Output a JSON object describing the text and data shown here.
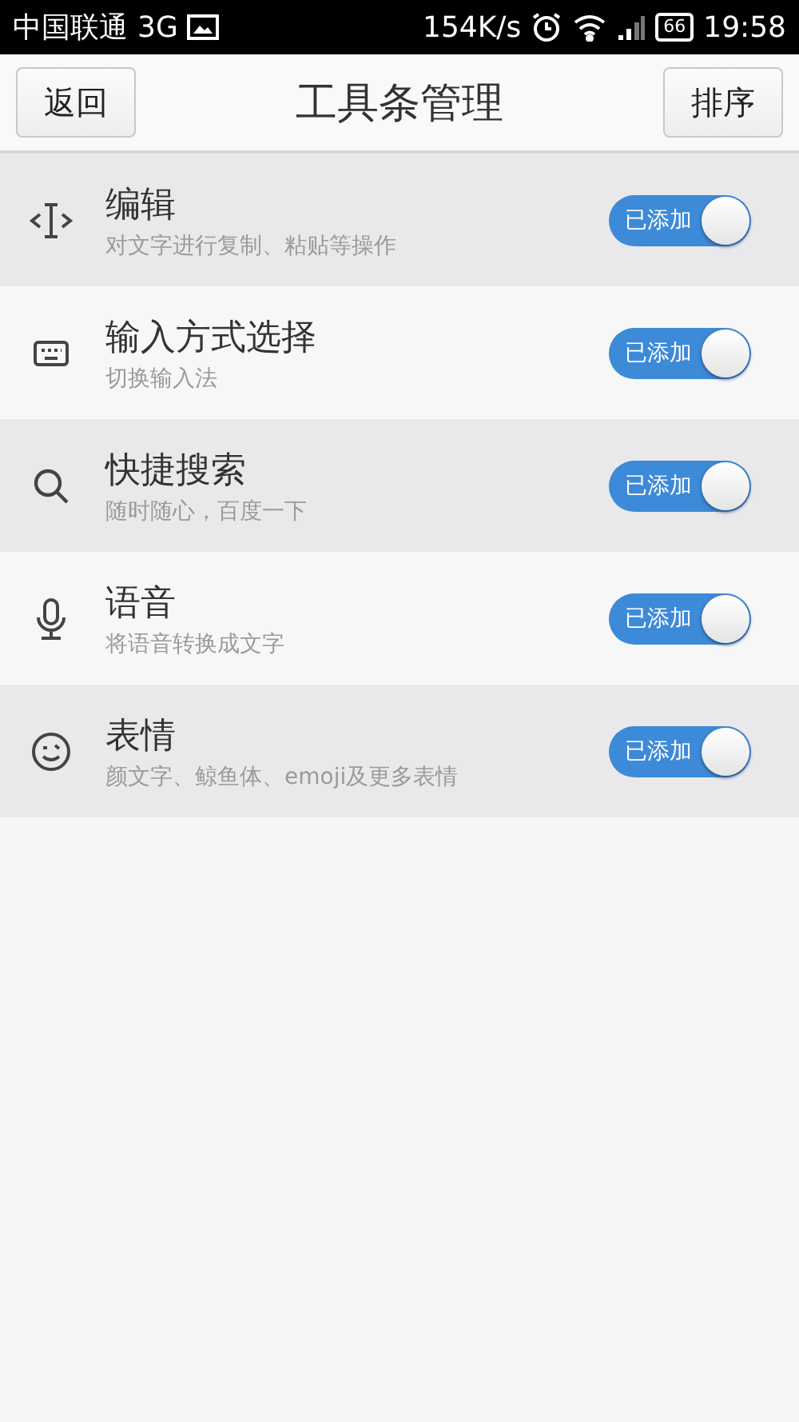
{
  "status_bar": {
    "carrier": "中国联通",
    "network": "3G",
    "speed": "154K/s",
    "battery": "66",
    "time": "19:58"
  },
  "header": {
    "back_button": "返回",
    "title": "工具条管理",
    "sort_button": "排序"
  },
  "tools": [
    {
      "kind": "edit",
      "name": "编辑",
      "description": "对文字进行复制、粘贴等操作",
      "toggle": {
        "label": "已添加",
        "on": true
      }
    },
    {
      "kind": "keyboard",
      "name": "输入方式选择",
      "description": "切换输入法",
      "toggle": {
        "label": "已添加",
        "on": true
      }
    },
    {
      "kind": "search",
      "name": "快捷搜索",
      "description": "随时随心，百度一下",
      "toggle": {
        "label": "已添加",
        "on": true
      }
    },
    {
      "kind": "voice",
      "name": "语音",
      "description": "将语音转换成文字",
      "toggle": {
        "label": "已添加",
        "on": true
      }
    },
    {
      "kind": "emoji",
      "name": "表情",
      "description": "颜文字、鲸鱼体、emoji及更多表情",
      "toggle": {
        "label": "已添加",
        "on": true
      }
    }
  ]
}
